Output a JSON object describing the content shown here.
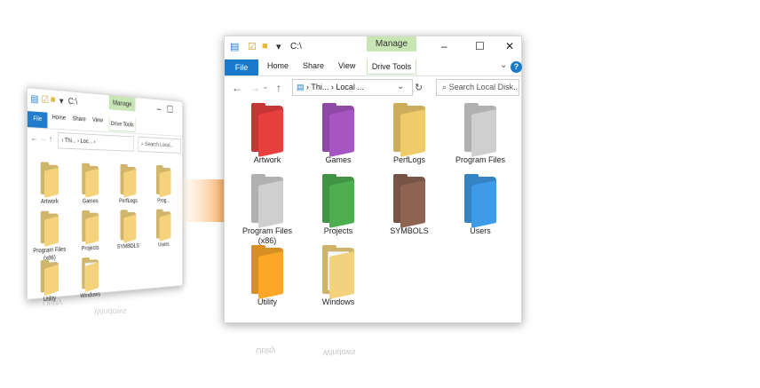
{
  "window": {
    "path_title": "C:\\",
    "manage_label": "Manage",
    "ribbon_tabs": [
      "File",
      "Home",
      "Share",
      "View"
    ],
    "drive_tools_label": "Drive Tools",
    "breadcrumb_front": "› Thi... › Local ...",
    "breadcrumb_back": "› Thi... › Loc... ›",
    "search_placeholder_front": "Search Local Disk...",
    "search_placeholder_back": "Search Local..."
  },
  "front_folders": [
    {
      "label": "Artwork",
      "color": "#e8403f"
    },
    {
      "label": "Games",
      "color": "#a755c2"
    },
    {
      "label": "PerfLogs",
      "color": "#f0cb69"
    },
    {
      "label": "Program Files",
      "color": "#cfcfcf"
    },
    {
      "label": "Program Files (x86)",
      "color": "#cfcfcf"
    },
    {
      "label": "Projects",
      "color": "#4cae4f"
    },
    {
      "label": "SYMBOLS",
      "color": "#8d6352"
    },
    {
      "label": "Users",
      "color": "#3d9be8"
    },
    {
      "label": "Utility",
      "color": "#fda728"
    },
    {
      "label": "Windows",
      "color": "#f2d27c"
    }
  ],
  "back_folders": [
    {
      "label": "Artwork"
    },
    {
      "label": "Games"
    },
    {
      "label": "PerfLogs"
    },
    {
      "label": "Prog..."
    },
    {
      "label": "Program Files (x86)"
    },
    {
      "label": "Projects"
    },
    {
      "label": "SYMBOLS"
    },
    {
      "label": "Users"
    },
    {
      "label": "Utility"
    },
    {
      "label": "Windows"
    }
  ],
  "colors": {
    "file_tab": "#1979ca",
    "manage": "#c7e6b4",
    "default_folder": "#f4d278",
    "arrow": "#f49332"
  },
  "reflection": {
    "front_left": "Utility",
    "front_right": "Windows",
    "back_left": "Utility",
    "back_right": "Windows"
  }
}
